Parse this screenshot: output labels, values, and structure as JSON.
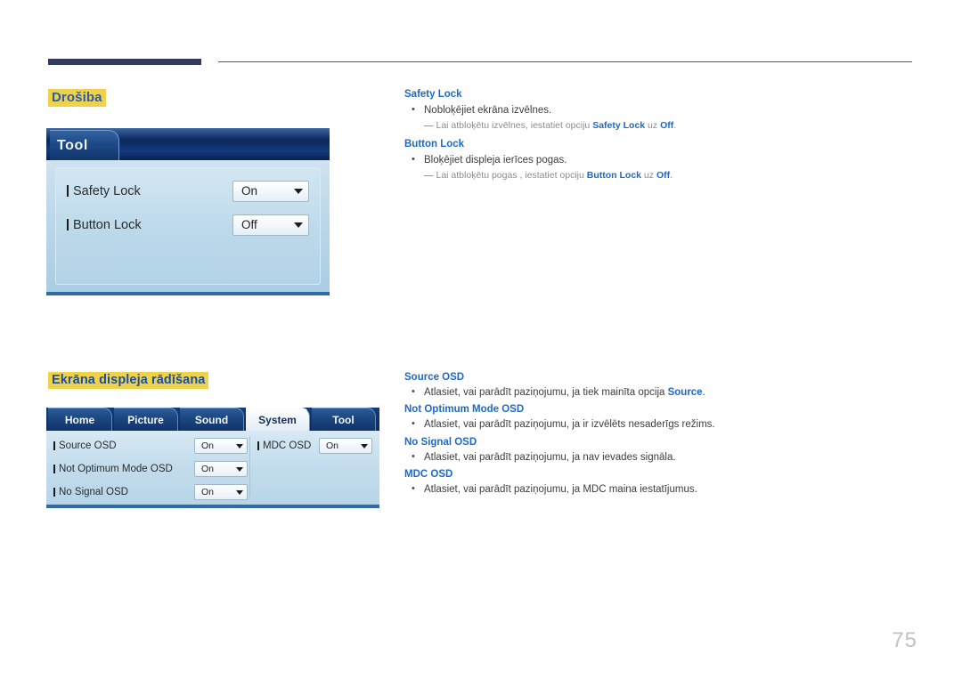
{
  "page": {
    "number": "75"
  },
  "sections": [
    {
      "heading": "Drošiba",
      "panel": {
        "tab_label": "Tool",
        "rows": [
          {
            "label": "Safety Lock",
            "value": "On"
          },
          {
            "label": "Button Lock",
            "value": "Off"
          }
        ]
      },
      "text_groups": [
        {
          "title": "Safety Lock",
          "bullet": "Nobloķējiet ekrāna izvēlnes.",
          "note_pre": "Lai atbloķētu izvēlnes, iestatiet opciju ",
          "note_b1": "Safety Lock",
          "note_mid": " uz ",
          "note_b2": "Off",
          "note_end": "."
        },
        {
          "title": "Button Lock",
          "bullet": "Bloķējiet displeja ierīces pogas.",
          "note_pre": "Lai atbloķētu pogas , iestatiet opciju ",
          "note_b1": "Button Lock",
          "note_mid": " uz ",
          "note_b2": "Off",
          "note_end": "."
        }
      ]
    },
    {
      "heading": "Ekrāna displeja rādīšana",
      "panel": {
        "tabs": [
          {
            "label": "Home",
            "active": false
          },
          {
            "label": "Picture",
            "active": false
          },
          {
            "label": "Sound",
            "active": false
          },
          {
            "label": "System",
            "active": true
          },
          {
            "label": "Tool",
            "active": false
          }
        ],
        "rows_left": [
          {
            "label": "Source OSD",
            "value": "On"
          },
          {
            "label": "Not Optimum Mode OSD",
            "value": "On"
          },
          {
            "label": "No Signal OSD",
            "value": "On"
          }
        ],
        "rows_right": [
          {
            "label": "MDC OSD",
            "value": "On"
          }
        ]
      },
      "text_groups": [
        {
          "title": "Source OSD",
          "bullet_pre": "Atlasiet, vai parādīt paziņojumu, ja tiek mainīta opcija ",
          "bullet_b": "Source",
          "bullet_end": "."
        },
        {
          "title": "Not Optimum Mode OSD",
          "bullet_pre": "Atlasiet, vai parādīt paziņojumu, ja ir izvēlēts nesaderīgs režims.",
          "bullet_b": "",
          "bullet_end": ""
        },
        {
          "title": "No Signal OSD",
          "bullet_pre": "Atlasiet, vai parādīt paziņojumu, ja nav ievades signāla.",
          "bullet_b": "",
          "bullet_end": ""
        },
        {
          "title": "MDC OSD",
          "bullet_pre": "Atlasiet, vai parādīt paziņojumu, ja MDC maina iestatījumus.",
          "bullet_b": "",
          "bullet_end": ""
        }
      ]
    }
  ],
  "colors": {
    "rule": "#333a5c",
    "highlight": "#efd24c",
    "heading_text": "#2a5caa",
    "link_blue": "#1e69c8",
    "osd_dark": "#0b2a5e",
    "osd_accent": "#2f6ca5",
    "page_number": "#c2c2c2"
  },
  "icons": {
    "bullet": "•",
    "dash": "—",
    "dropdown_arrow": "▼",
    "row_tick": "▌"
  }
}
